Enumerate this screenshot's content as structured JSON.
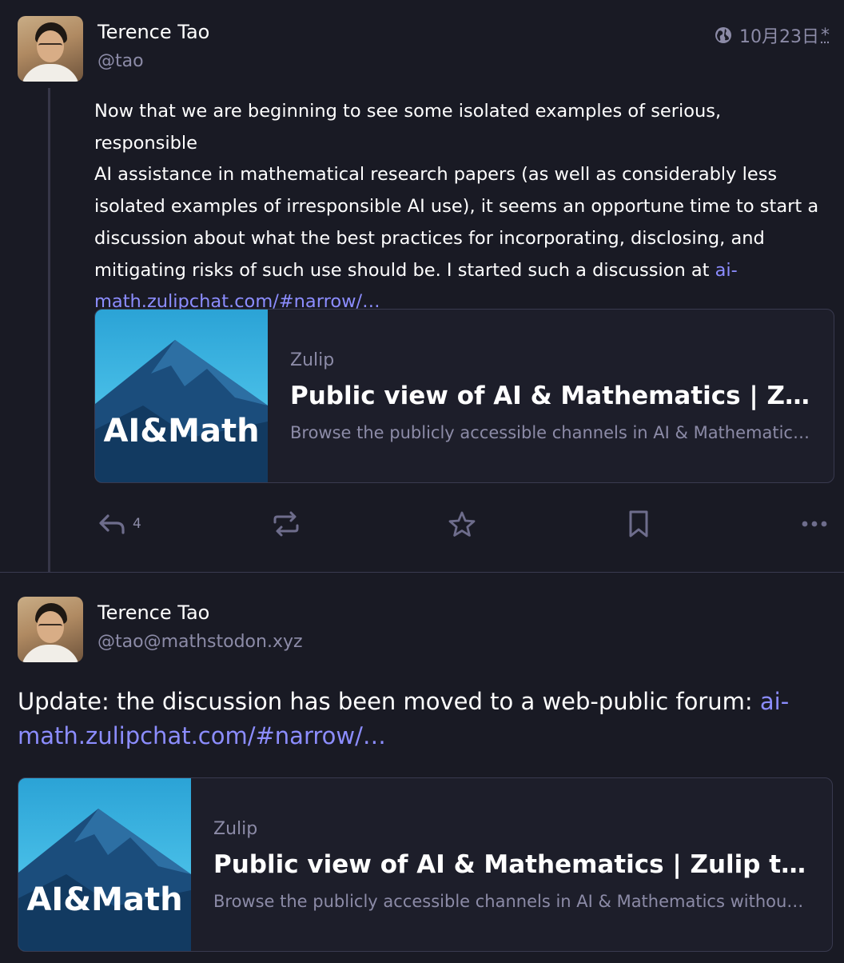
{
  "post1": {
    "author_name": "Terence Tao",
    "handle": "@tao",
    "date": "10月23日",
    "date_suffix": "*",
    "content_lines": [
      "Now that we are beginning to see some isolated examples of serious, responsible",
      "AI assistance in mathematical research papers (as well as considerably less",
      "isolated examples of irresponsible AI use), it seems an opportune time to start a",
      "discussion about what the best practices for incorporating, disclosing, and",
      "mitigating risks of such use should be.  I started such a discussion at "
    ],
    "link_part1": "ai-",
    "link_part2": "math.zulipchat.com/#narrow/…",
    "card": {
      "site": "Zulip",
      "title": "Public view of AI & Mathematics | Zulip team chat",
      "description": "Browse the publicly accessible channels in AI & Mathematics without logging in.",
      "thumb_text": "AI&Math"
    },
    "reply_count": "4"
  },
  "post2": {
    "author_name": "Terence Tao",
    "handle": "@tao@mathstodon.xyz",
    "content_line1": "Update: the discussion has been moved to a web-public forum: ",
    "link_part1": "ai-",
    "link_part2": "math.zulipchat.com/#narrow/…",
    "card": {
      "site": "Zulip",
      "title": "Public view of AI & Mathematics | Zulip team chat",
      "description": "Browse the publicly accessible channels in AI & Mathematics without logging in.",
      "thumb_text": "AI&Math"
    }
  },
  "icons": {
    "globe": "globe-icon",
    "reply": "reply-icon",
    "boost": "boost-icon",
    "favourite": "star-icon",
    "bookmark": "bookmark-icon",
    "more": "more-icon"
  },
  "colors": {
    "background": "#191a24",
    "link": "#8c8dff",
    "muted": "#8c8ba7",
    "border": "#393a4f"
  }
}
